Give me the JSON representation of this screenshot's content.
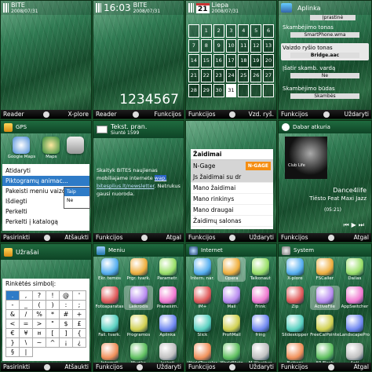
{
  "t1": {
    "operator": "BITE",
    "date": "2008/07/31",
    "sk": [
      "Reader",
      "X-plore"
    ]
  },
  "t2": {
    "time": "16:03",
    "operator": "BITE",
    "date": "2008/07/31",
    "number": "1234567",
    "sk": [
      "Reader",
      "Funkcijos"
    ]
  },
  "t3": {
    "day": "21",
    "month": "Liepa",
    "date": "2008/07/31",
    "sk": [
      "Funkcijos",
      "Vzd. ryš."
    ],
    "rows": [
      [
        "",
        "1",
        "2",
        "3",
        "4",
        "5",
        "6"
      ],
      [
        "7",
        "8",
        "9",
        "10",
        "11",
        "12",
        "13"
      ],
      [
        "14",
        "15",
        "16",
        "17",
        "18",
        "19",
        "20"
      ],
      [
        "21",
        "22",
        "23",
        "24",
        "25",
        "26",
        "27"
      ],
      [
        "28",
        "29",
        "30",
        "31",
        "",
        "",
        ""
      ]
    ]
  },
  "t4": {
    "title": "Aplinka",
    "subtitle": "Įprastinė",
    "sk": [
      "Funkcijos",
      "Uždaryti"
    ],
    "items": [
      {
        "label": "Skambėjimo tonas",
        "value": "SmartPhone.wma"
      },
      {
        "label": "Vaizdo ryšio tonas",
        "value": "Bridge.aac"
      },
      {
        "label": "Įšatir skamb. vardą",
        "value": "Ne"
      },
      {
        "label": "Skambėjimo būdas",
        "value": "Skambės"
      }
    ]
  },
  "t5": {
    "app": "GPS",
    "apps": [
      "Google Maps",
      "Maps",
      ""
    ],
    "menu": [
      "Atidaryti",
      "Piktogramų animac...",
      "Pakeisti meniu vaizdą",
      "Išdiegti",
      "Perkelti",
      "Perkelti į katalogą"
    ],
    "sub": [
      "Taip",
      "Ne"
    ],
    "sk": [
      "Pasirinkti",
      "Atšaukti"
    ]
  },
  "t6": {
    "header": "Tekst. pran.",
    "sender": "Siuntė",
    "number": "1599",
    "body1": "Skaityk BITES naujienas mobiliajame internete ",
    "link1": "wap.",
    "link2": "bitesplius.lt/newsletter",
    "body2": ". Netrukus gausi nuoroda.",
    "sk": [
      "Funkcijos",
      "Atgal"
    ]
  },
  "t7": {
    "header": "Žaidimai",
    "ngage": "N-Gage",
    "banner": "N-GAGE",
    "items": [
      "Js žaidimai su dr",
      "Mano žaidimai",
      "Mano rinkinys",
      "Mano draugai",
      "Žaidimų salonas"
    ],
    "sk": [
      "Funkcijos",
      "Uždaryti"
    ]
  },
  "t8": {
    "header": "Dabar atkuria",
    "cover": "Club Life",
    "artist": "Tiësto Feat Maxi Jazz",
    "track": "Dance4life",
    "time": "(05:21)",
    "sk": [
      "Funkcijos",
      "Atgal"
    ]
  },
  "t9": {
    "header": "Užrašai",
    "panel": "Rinkėtės simbolį:",
    "symbols": [
      ".",
      ",",
      "?",
      "!",
      "@",
      "'",
      "-",
      "_",
      "(",
      ")",
      ":",
      ";",
      "&",
      "/",
      "%",
      "*",
      "#",
      "+",
      "<",
      "=",
      ">",
      "\"",
      "$",
      "£",
      "€",
      "¥",
      "¤",
      "[",
      "]",
      "{",
      "}",
      "\\",
      "~",
      "^",
      "¡",
      "¿",
      "§",
      "|"
    ],
    "sk": [
      "Pasirinkti",
      "Atšaukti"
    ]
  },
  "t10": {
    "header": "Meniu",
    "apps": [
      "Ekr. temos",
      "Prgr. tvark.",
      "Parametr.",
      "Fotoaparatas",
      "Laikrodis",
      "Pranešim.",
      "Fail. tvark.",
      "Programos",
      "Aplinka",
      "Internet",
      "Muzika",
      "Ieškoti"
    ],
    "sk": [
      "Funkcijos",
      "Uždaryti"
    ]
  },
  "t11": {
    "header": "Internet",
    "apps": [
      "Intern. nar.",
      "Opera",
      "Talkonaut",
      "IM+",
      "Mail",
      "Frink",
      "Slick",
      "ProfiMail",
      "fring",
      "WorldTraveler",
      "WorldMate",
      "M-Weather"
    ],
    "sk": [
      "Funkcijos",
      "Uždaryti"
    ]
  },
  "t12": {
    "header": "System",
    "apps": [
      "X-plore",
      "FSCaller",
      "Dailas",
      "Zip",
      "ActiveFile",
      "AppSwitcher",
      "Slideskipper",
      "FreeCalPointe",
      "LandscapePro",
      "Battery",
      "AP Flash",
      "Anti"
    ],
    "sk": [
      "Funkcijos",
      "Atgal"
    ]
  }
}
